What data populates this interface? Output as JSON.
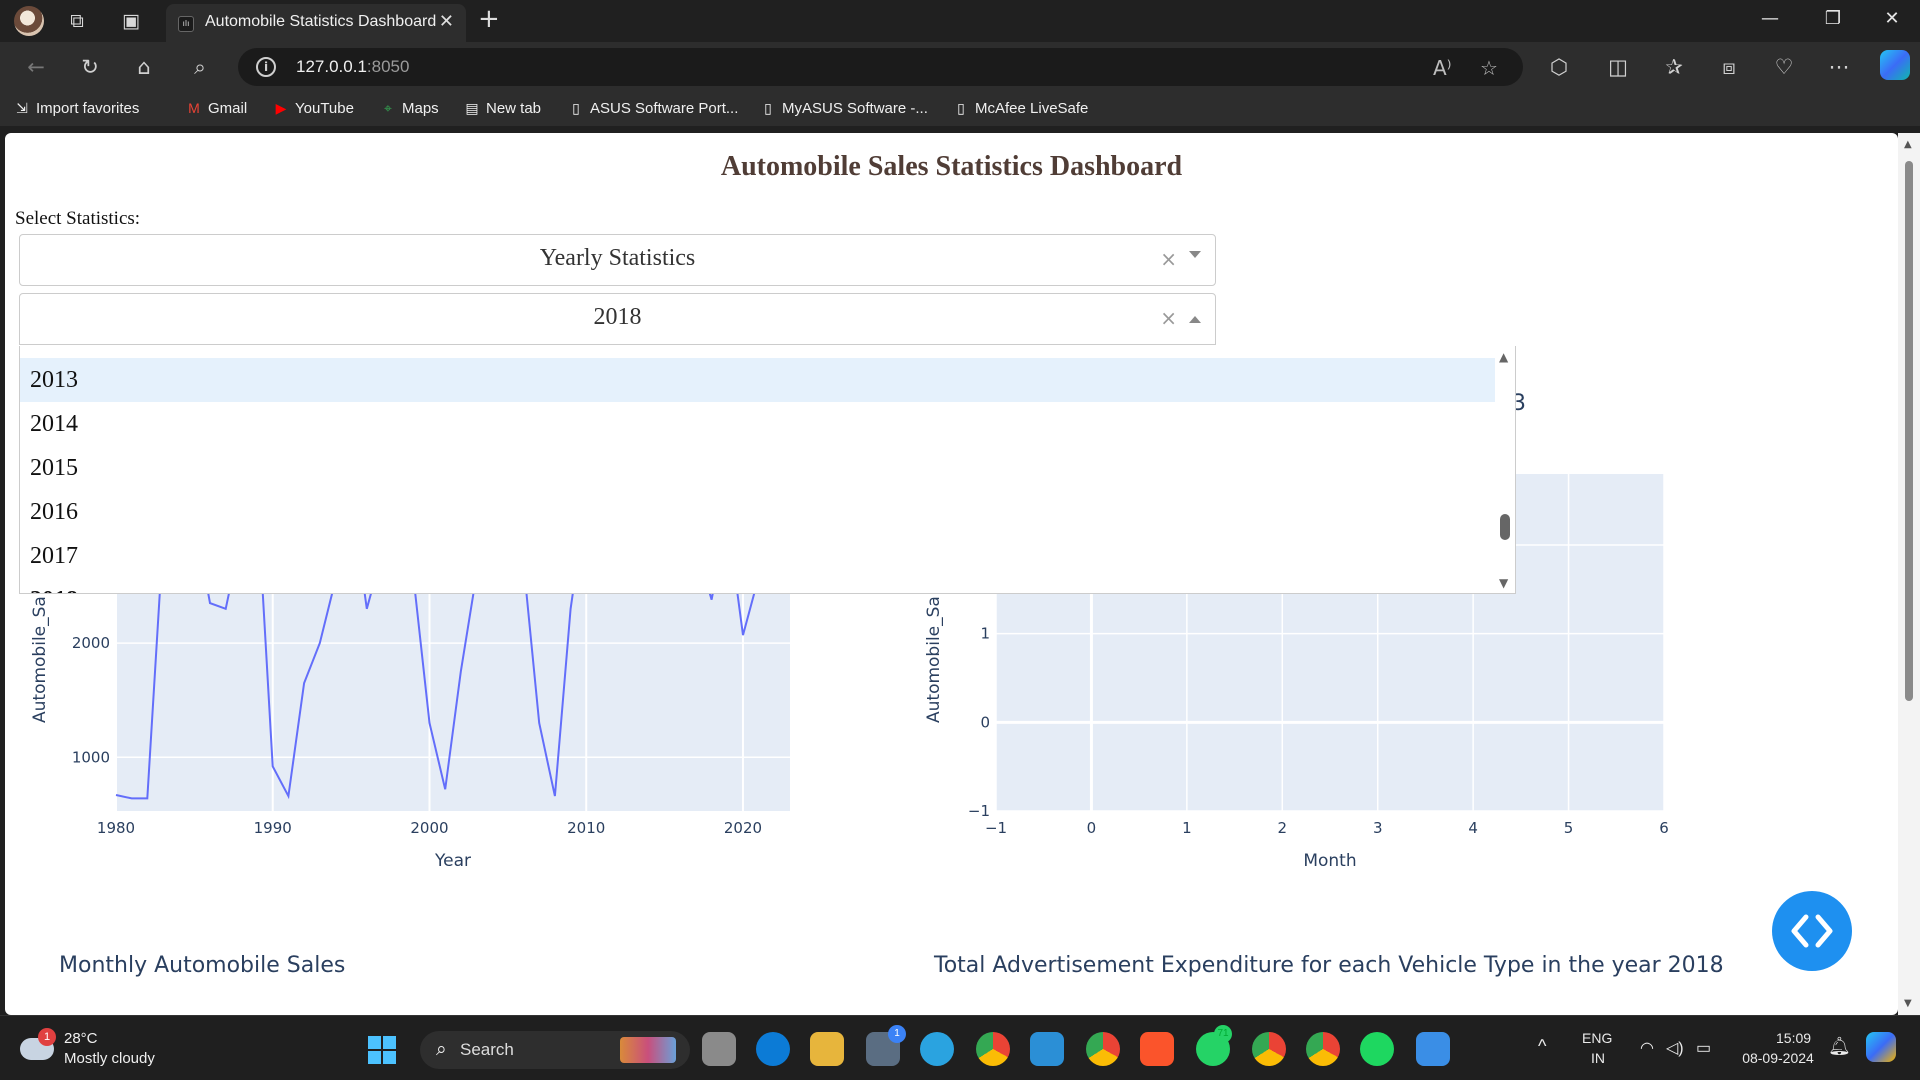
{
  "browser": {
    "tab_title": "Automobile Statistics Dashboard",
    "tab_favicon": "dash-icon",
    "url_host": "127.0.0.1",
    "url_port": ":8050",
    "favorites": [
      {
        "label": "Import favorites",
        "icon": "import-icon"
      },
      {
        "label": "Gmail",
        "icon": "gmail-icon"
      },
      {
        "label": "YouTube",
        "icon": "youtube-icon"
      },
      {
        "label": "Maps",
        "icon": "maps-icon"
      },
      {
        "label": "New tab",
        "icon": "newtab-icon"
      },
      {
        "label": "ASUS Software Port...",
        "icon": "page-icon"
      },
      {
        "label": "MyASUS Software -...",
        "icon": "page-icon"
      },
      {
        "label": "McAfee LiveSafe",
        "icon": "page-icon"
      }
    ]
  },
  "dashboard": {
    "title": "Automobile Sales Statistics Dashboard",
    "select_label": "Select Statistics:",
    "stat_dropdown_value": "Yearly Statistics",
    "year_dropdown_value": "2018",
    "year_options": [
      "2013",
      "2014",
      "2015",
      "2016",
      "2017",
      "2018"
    ],
    "highlighted_option": "2013",
    "hidden_title_fragment": "3",
    "bottom_left_title": "Monthly Automobile Sales",
    "bottom_right_title": "Total Advertisement Expenditure for each Vehicle Type in the year 2018"
  },
  "chart_data": [
    {
      "type": "line",
      "title": "",
      "xlabel": "Year",
      "ylabel": "Automobile_Sa",
      "xlim": [
        1980,
        2023
      ],
      "ylim": [
        530,
        3200
      ],
      "xticks": [
        "1980",
        "1990",
        "2000",
        "2010",
        "2020"
      ],
      "yticks": [
        "1000",
        "2000",
        "3000"
      ],
      "line_color": "#636efa",
      "x": [
        1980,
        1981,
        1982,
        1983,
        1984,
        1985,
        1986,
        1987,
        1988,
        1989,
        1990,
        1991,
        1992,
        1993,
        1994,
        1995,
        1996,
        1997,
        1998,
        1999,
        2000,
        2001,
        2002,
        2003,
        2004,
        2005,
        2006,
        2007,
        2008,
        2009,
        2010,
        2011,
        2012,
        2013,
        2014,
        2015,
        2016,
        2017,
        2018,
        2019,
        2020,
        2021,
        2022,
        2023
      ],
      "y": [
        670,
        640,
        640,
        2900,
        2950,
        3100,
        2350,
        2300,
        2950,
        3300,
        920,
        660,
        1650,
        2000,
        2550,
        3300,
        2300,
        2800,
        2950,
        2550,
        1300,
        720,
        1750,
        2600,
        3150,
        2550,
        2700,
        1300,
        660,
        2300,
        3250,
        2800,
        2480,
        3200,
        2850,
        2520,
        3200,
        2850,
        2380,
        3100,
        2070,
        2580,
        2600,
        2620
      ]
    },
    {
      "type": "line",
      "title": "",
      "xlabel": "Month",
      "ylabel": "Automobile_Sa",
      "xlim": [
        -1,
        6
      ],
      "ylim": [
        -1,
        2.8
      ],
      "xticks": [
        "−1",
        "0",
        "1",
        "2",
        "3",
        "4",
        "5",
        "6"
      ],
      "yticks": [
        "−1",
        "0",
        "1",
        "2"
      ],
      "series": []
    }
  ],
  "taskbar": {
    "weather_temp": "28°C",
    "weather_desc": "Mostly cloudy",
    "weather_badge": "1",
    "search_label": "Search",
    "lang_top": "ENG",
    "lang_bottom": "IN",
    "time": "15:09",
    "date": "08-09-2024",
    "app_badges": [
      "1",
      "71"
    ]
  }
}
